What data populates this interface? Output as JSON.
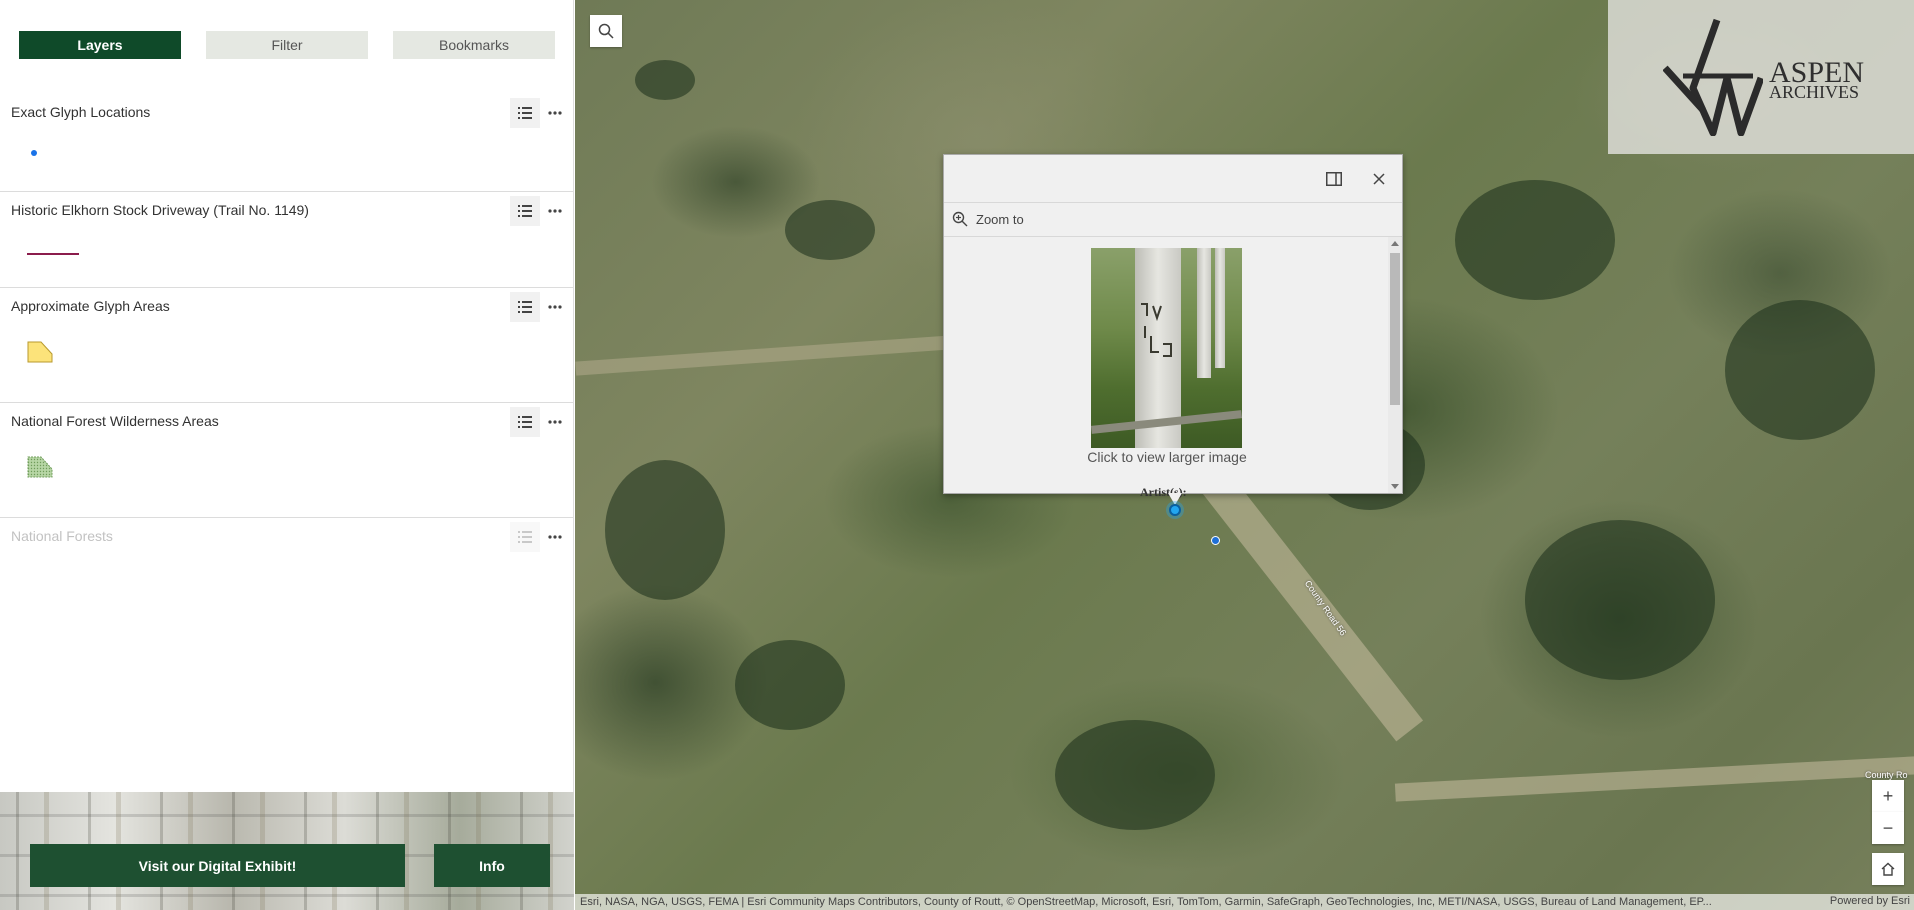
{
  "tabs": {
    "layers": "Layers",
    "filter": "Filter",
    "bookmarks": "Bookmarks"
  },
  "layers": [
    {
      "title": "Exact Glyph Locations",
      "legend_type": "point",
      "color": "#1a73e8"
    },
    {
      "title": "Historic Elkhorn Stock Driveway (Trail No. 1149)",
      "legend_type": "line",
      "color": "#8b1c4c"
    },
    {
      "title": "Approximate Glyph Areas",
      "legend_type": "polygon",
      "color": "#fce37a"
    },
    {
      "title": "National Forest Wilderness Areas",
      "legend_type": "polygon-hatched",
      "color": "#9fc48a"
    },
    {
      "title": "National Forests",
      "legend_type": "none",
      "dimmed": true
    }
  ],
  "footer_buttons": {
    "exhibit": "Visit our Digital Exhibit!",
    "info": "Info"
  },
  "logo": {
    "line1": "ASPEN",
    "line2": "ARCHIVES"
  },
  "popup": {
    "zoom_to": "Zoom to",
    "caption": "Click to view larger image",
    "artist_label": "Artist(s):"
  },
  "map_labels": {
    "road1": "County Road 56",
    "road2": "County Ro"
  },
  "attribution": {
    "text": "Esri, NASA, NGA, USGS, FEMA | Esri Community Maps Contributors, County of Routt, © OpenStreetMap, Microsoft, Esri, TomTom, Garmin, SafeGraph, GeoTechnologies, Inc, METI/NASA, USGS, Bureau of Land Management, EP...",
    "powered": "Powered by Esri"
  },
  "icons": {
    "search": "search-icon",
    "legend": "legend-list-icon",
    "more": "ellipsis-icon",
    "dock": "dock-icon",
    "close": "close-icon",
    "zoom_to": "zoom-in-magnifier-icon",
    "home": "home-icon"
  }
}
